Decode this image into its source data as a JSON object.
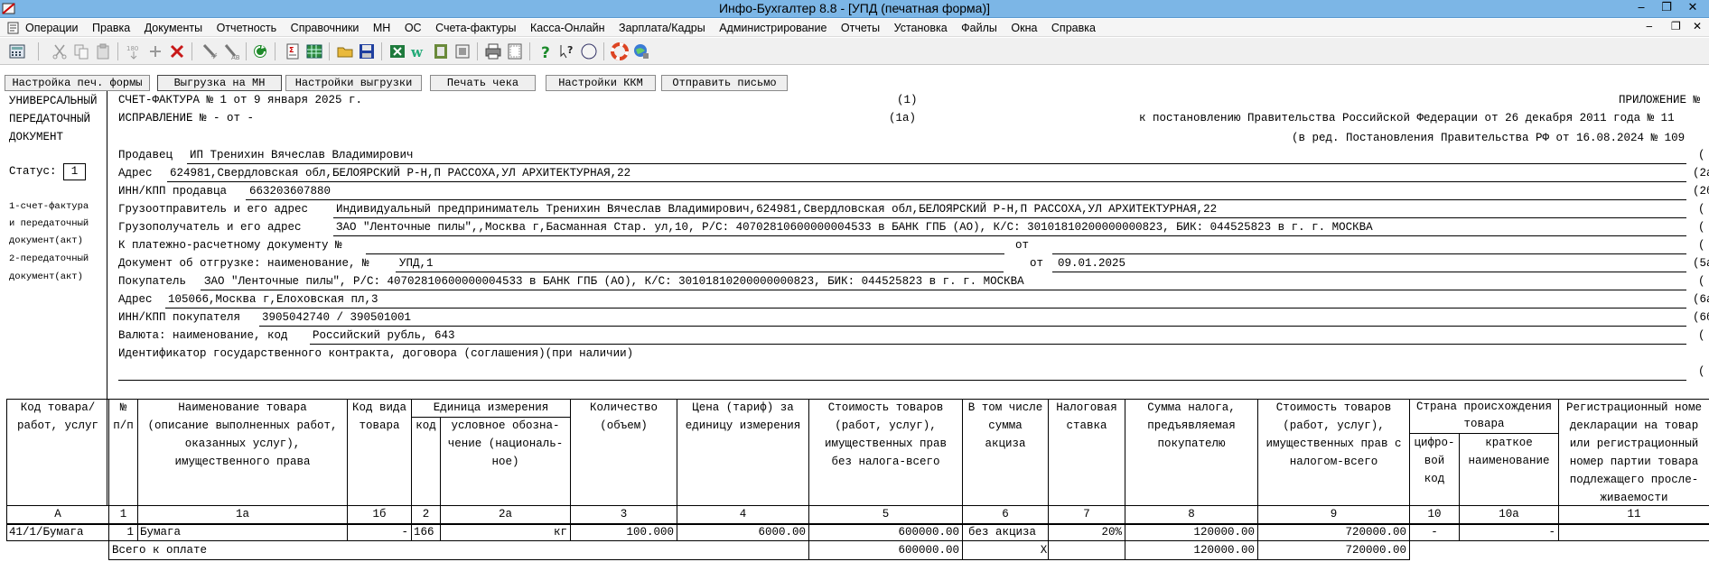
{
  "window": {
    "title": "Инфо-Бухгалтер 8.8 - [УПД (печатная форма)]",
    "minimize": "‒",
    "restore": "❐",
    "close": "✕"
  },
  "menu": [
    "Операции",
    "Правка",
    "Документы",
    "Отчетность",
    "Справочники",
    "МН",
    "ОС",
    "Счета-фактуры",
    "Касса-Онлайн",
    "Зарплата/Кадры",
    "Администрирование",
    "Отчеты",
    "Установка",
    "Файлы",
    "Окна",
    "Справка"
  ],
  "actions": {
    "print_setup": "Настройка печ. формы",
    "export_mn": "Выгрузка на МН",
    "export_settings": "Настройки выгрузки",
    "print_receipt": "Печать чека",
    "kkm_settings": "Настройки ККМ",
    "send_letter": "Отправить письмо"
  },
  "left": {
    "line1": "УНИВЕРСАЛЬНЫЙ",
    "line2": "ПЕРЕДАТОЧНЫЙ",
    "line3": "ДОКУМЕНТ",
    "status_label": "Статус:",
    "status_value": "1",
    "note1": "1-счет-фактура",
    "note2": "и передаточный",
    "note3": "документ(акт)",
    "note4": "2-передаточный",
    "note5": "документ(акт)"
  },
  "header": {
    "invoice": "СЧЕТ-ФАКТУРА №  1  от  9 января 2025 г.",
    "mark1": "(1)",
    "correction": "ИСПРАВЛЕНИЕ №  -   от  -",
    "mark1a": "(1а)",
    "appendix": "ПРИЛОЖЕНИЕ №",
    "decree": "к постановлению Правительства Российской Федерации от 26 декабря 2011 года № 11",
    "decree_rev": "(в ред. Постановления Правительства РФ от 16.08.2024 № 109",
    "seller_label": "Продавец",
    "seller": "ИП Тренихин Вячеслав Владимирович",
    "address_label": "Адрес",
    "address": "624981,Свердловская обл,БЕЛОЯРСКИЙ Р-Н,П РАССОХА,УЛ АРХИТЕКТУРНАЯ,22",
    "mark2a": "(2а",
    "inn_label": "ИНН/КПП продавца",
    "inn": "663203607880",
    "mark2b": "(2б",
    "shipper_label": "Грузоотправитель и его адрес",
    "shipper": "Индивидуальный предприниматель Тренихин Вячеслав Владимирович,624981,Свердловская обл,БЕЛОЯРСКИЙ Р-Н,П РАССОХА,УЛ АРХИТЕКТУРНАЯ,22",
    "consignee_label": "Грузополучатель  и его адрес",
    "consignee": "ЗАО \"Ленточные пилы\",,Москва г,Басманная Стар. ул,10, Р/С: 40702810600000004533 в БАНК ГПБ (АО), К/С: 30101810200000000823, БИК: 044525823 в г. г. МОСКВА",
    "payment_label": "К платежно-расчетному документу №",
    "payment_from": "от",
    "shipment_label": "Документ об отгрузке: наименование, №",
    "shipment": "УПД,1",
    "shipment_from": "от",
    "shipment_date": "09.01.2025",
    "mark5a": "(5а",
    "buyer_label": "Покупатель",
    "buyer": "ЗАО \"Ленточные пилы\", Р/С: 40702810600000004533 в БАНК ГПБ (АО), К/С: 30101810200000000823, БИК: 044525823 в г. г. МОСКВА",
    "buyer_address_label": "Адрес",
    "buyer_address": "105066,Москва г,Елоховская пл,3",
    "mark6a": "(6а",
    "buyer_inn_label": "ИНН/КПП покупателя",
    "buyer_inn": "3905042740 / 390501001",
    "mark6b": "(6б",
    "currency_label": "Валюта: наименование, код",
    "currency": "Российский рубль, 643",
    "contract_label": "Идентификатор государственного контракта, договора (соглашения)(при наличии)",
    "paren": "("
  },
  "table": {
    "h_code": [
      "Код товара/",
      "работ, услуг"
    ],
    "h_no": [
      "№",
      "п/п"
    ],
    "h_name": [
      "Наименование товара",
      "(описание выполненных работ,",
      "оказанных услуг),",
      "имущественного права"
    ],
    "h_kind": [
      "Код вида",
      "товара"
    ],
    "h_unit": "Единица измерения",
    "h_unit_code": "код",
    "h_unit_name": [
      "условное обозна-",
      "чение (националь-",
      "ное)"
    ],
    "h_qty": [
      "Количество",
      "(объем)"
    ],
    "h_price": [
      "Цена (тариф) за",
      "единицу измерения"
    ],
    "h_cost": [
      "Стоимость товаров",
      "(работ, услуг),",
      "имущественных прав",
      "без налога-всего"
    ],
    "h_excise": [
      "В том числе",
      "сумма",
      "акциза"
    ],
    "h_rate": [
      "Налоговая",
      "ставка"
    ],
    "h_tax": [
      "Сумма налога,",
      "предъявляемая",
      "покупателю"
    ],
    "h_total": [
      "Стоимость товаров",
      "(работ, услуг),",
      "имущественных прав с",
      "налогом-всего"
    ],
    "h_country": [
      "Страна происхождения",
      "товара"
    ],
    "h_country_code": [
      "цифро-",
      "вой",
      "код"
    ],
    "h_country_name": [
      "краткое",
      "наименование"
    ],
    "h_reg": [
      "Регистрационный номе",
      "декларации на товар",
      "или регистрационный",
      "номер партии товара",
      "подлежащего просле-",
      "живаемости"
    ],
    "nums": [
      "А",
      "1",
      "1а",
      "1б",
      "2",
      "2а",
      "3",
      "4",
      "5",
      "6",
      "7",
      "8",
      "9",
      "10",
      "10а",
      "11"
    ],
    "row": {
      "code": "41/1/Бумага",
      "no": "1",
      "name": "Бумага",
      "kind": "-",
      "unit_code": "166",
      "unit_name": "кг",
      "qty": "100.000",
      "price": "6000.00",
      "cost": "600000.00",
      "excise": "без акциза",
      "rate": "20%",
      "tax": "120000.00",
      "total": "720000.00",
      "country_code": "-",
      "country_name": "-"
    },
    "footer": {
      "label": "Всего к оплате",
      "cost": "600000.00",
      "excise": "X",
      "tax": "120000.00",
      "total": "720000.00"
    }
  }
}
